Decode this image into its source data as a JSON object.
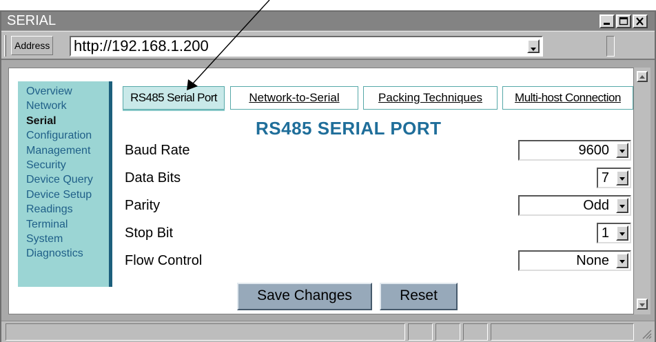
{
  "window": {
    "title": "SERIAL",
    "controls": [
      "minimize-icon",
      "maximize-icon",
      "close-icon"
    ]
  },
  "address_bar": {
    "label": "Address",
    "url": "http://192.168.1.200"
  },
  "sidebar": {
    "items": [
      {
        "label": "Overview",
        "active": false
      },
      {
        "label": "Network",
        "active": false
      },
      {
        "label": "Serial",
        "active": true
      },
      {
        "label": "Configuration",
        "active": false
      },
      {
        "label": "Management",
        "active": false
      },
      {
        "label": "Security",
        "active": false
      },
      {
        "label": "Device Query",
        "active": false
      },
      {
        "label": "Device Setup",
        "active": false
      },
      {
        "label": "Readings",
        "active": false
      },
      {
        "label": "Terminal",
        "active": false
      },
      {
        "label": "System",
        "active": false
      },
      {
        "label": "Diagnostics",
        "active": false
      }
    ]
  },
  "tabs": [
    {
      "label": "RS485 Serial Port",
      "active": true
    },
    {
      "label": "Network-to-Serial",
      "active": false
    },
    {
      "label": "Packing Techniques",
      "active": false
    },
    {
      "label": "Multi-host Connection",
      "active": false
    }
  ],
  "form": {
    "heading": "RS485 SERIAL PORT",
    "fields": {
      "baud_rate": {
        "label": "Baud Rate",
        "value": "9600"
      },
      "data_bits": {
        "label": "Data Bits",
        "value": "7"
      },
      "parity": {
        "label": "Parity",
        "value": "Odd"
      },
      "stop_bit": {
        "label": "Stop Bit",
        "value": "1"
      },
      "flow_control": {
        "label": "Flow Control",
        "value": "None"
      }
    },
    "buttons": {
      "save": "Save Changes",
      "reset": "Reset"
    }
  },
  "colors": {
    "sidebar_bg": "#9bd5d4",
    "sidebar_border": "#1c5f7c",
    "nav_text": "#1f5f88",
    "heading": "#1f6e9a",
    "active_tab_bg": "#c9e9e9",
    "button_bg": "#97a9ba",
    "titlebar": "#838383"
  }
}
